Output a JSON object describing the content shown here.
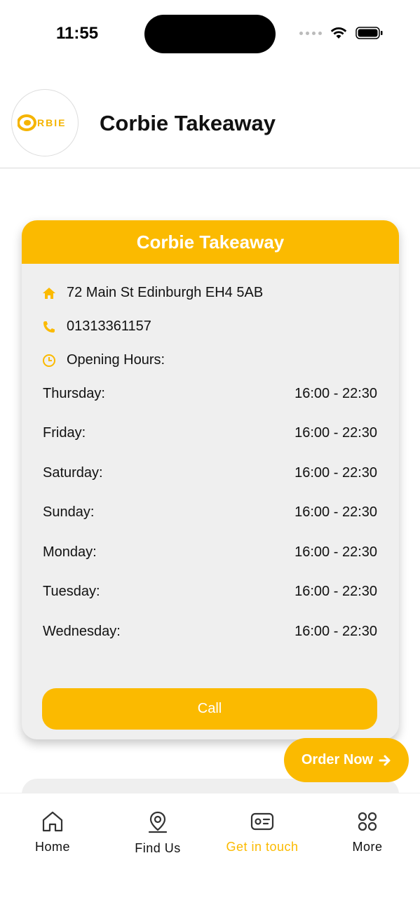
{
  "status_bar": {
    "time": "11:55"
  },
  "header": {
    "title": "Corbie Takeaway",
    "logo_text": "CORBIE"
  },
  "card": {
    "title": "Corbie Takeaway",
    "address": "72 Main St Edinburgh EH4 5AB",
    "phone": "01313361157",
    "opening_hours_label": "Opening Hours:",
    "hours": [
      {
        "day": "Thursday:",
        "time": "16:00 - 22:30"
      },
      {
        "day": "Friday:",
        "time": "16:00 - 22:30"
      },
      {
        "day": "Saturday:",
        "time": "16:00 - 22:30"
      },
      {
        "day": "Sunday:",
        "time": "16:00 - 22:30"
      },
      {
        "day": "Monday:",
        "time": "16:00 - 22:30"
      },
      {
        "day": "Tuesday:",
        "time": "16:00 - 22:30"
      },
      {
        "day": "Wednesday:",
        "time": "16:00 - 22:30"
      }
    ],
    "call_label": "Call"
  },
  "order_now": {
    "label": "Order Now"
  },
  "tabbar": {
    "items": [
      {
        "label": "Home",
        "icon": "home-icon"
      },
      {
        "label": "Find Us",
        "icon": "location-pin-icon"
      },
      {
        "label": "Get in touch",
        "icon": "contact-card-icon",
        "active": true
      },
      {
        "label": "More",
        "icon": "grid-icon"
      }
    ]
  },
  "colors": {
    "accent": "#fbba00",
    "card_bg": "#efefef"
  }
}
